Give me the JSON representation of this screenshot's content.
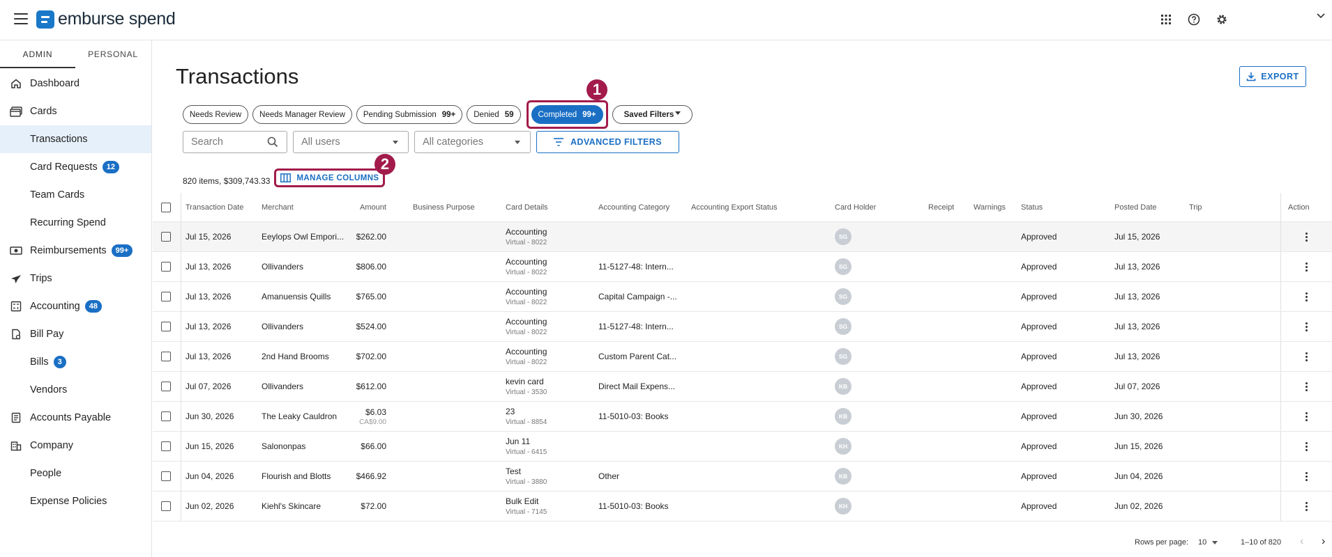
{
  "app": {
    "brand": "emburse spend"
  },
  "sidebar": {
    "tabs": [
      {
        "label": "ADMIN"
      },
      {
        "label": "PERSONAL"
      }
    ],
    "items": [
      {
        "label": "Dashboard",
        "icon": "home-icon"
      },
      {
        "label": "Cards",
        "icon": "cards-icon"
      },
      {
        "label": "Transactions"
      },
      {
        "label": "Card Requests",
        "badge": "12"
      },
      {
        "label": "Team Cards"
      },
      {
        "label": "Recurring Spend"
      },
      {
        "label": "Reimbursements",
        "badge": "99+",
        "icon": "reimbursement-icon"
      },
      {
        "label": "Trips",
        "icon": "airplane-icon"
      },
      {
        "label": "Accounting",
        "badge": "48",
        "icon": "accounting-icon"
      },
      {
        "label": "Bill Pay",
        "icon": "bill-icon"
      },
      {
        "label": "Bills",
        "badge": "3"
      },
      {
        "label": "Vendors"
      },
      {
        "label": "Accounts Payable",
        "icon": "accounts-payable-icon"
      },
      {
        "label": "Company",
        "icon": "company-icon"
      },
      {
        "label": "People"
      },
      {
        "label": "Expense Policies"
      }
    ]
  },
  "main": {
    "title": "Transactions",
    "export_label": "EXPORT",
    "chips": [
      {
        "label": "Needs Review",
        "count": ""
      },
      {
        "label": "Needs Manager Review",
        "count": ""
      },
      {
        "label": "Pending Submission",
        "count": "99+"
      },
      {
        "label": "Denied",
        "count": "59"
      },
      {
        "label": "Completed",
        "count": "99+"
      }
    ],
    "saved_filters_label": "Saved Filters",
    "markers": [
      "1",
      "2"
    ],
    "search_placeholder": "Search",
    "users_select": "All users",
    "categories_select": "All categories",
    "advanced_filters_label": "ADVANCED FILTERS",
    "summary": "820 items, $309,743.33",
    "manage_columns_label": "MANAGE COLUMNS",
    "columns": [
      "Transaction Date",
      "Merchant",
      "Amount",
      "Business Purpose",
      "Card Details",
      "Accounting Category",
      "Accounting Export Status",
      "Card Holder",
      "Receipt",
      "Warnings",
      "Status",
      "Posted Date",
      "Trip",
      "Action"
    ],
    "rows": [
      {
        "date": "Jul 15, 2026",
        "merchant": "Eeylops Owl Empori...",
        "amount": "$262.00",
        "amount_sub": "",
        "card": "Accounting",
        "card_sub": "Virtual - 8022",
        "category": "",
        "holder": "SG",
        "status": "Approved",
        "posted": "Jul 15, 2026"
      },
      {
        "date": "Jul 13, 2026",
        "merchant": "Ollivanders",
        "amount": "$806.00",
        "amount_sub": "",
        "card": "Accounting",
        "card_sub": "Virtual - 8022",
        "category": "11-5127-48: Intern...",
        "holder": "SG",
        "status": "Approved",
        "posted": "Jul 13, 2026"
      },
      {
        "date": "Jul 13, 2026",
        "merchant": "Amanuensis Quills",
        "amount": "$765.00",
        "amount_sub": "",
        "card": "Accounting",
        "card_sub": "Virtual - 8022",
        "category": "Capital Campaign -...",
        "holder": "SG",
        "status": "Approved",
        "posted": "Jul 13, 2026"
      },
      {
        "date": "Jul 13, 2026",
        "merchant": "Ollivanders",
        "amount": "$524.00",
        "amount_sub": "",
        "card": "Accounting",
        "card_sub": "Virtual - 8022",
        "category": "11-5127-48: Intern...",
        "holder": "SG",
        "status": "Approved",
        "posted": "Jul 13, 2026"
      },
      {
        "date": "Jul 13, 2026",
        "merchant": "2nd Hand Brooms",
        "amount": "$702.00",
        "amount_sub": "",
        "card": "Accounting",
        "card_sub": "Virtual - 8022",
        "category": "Custom Parent Cat...",
        "holder": "SG",
        "status": "Approved",
        "posted": "Jul 13, 2026"
      },
      {
        "date": "Jul 07, 2026",
        "merchant": "Ollivanders",
        "amount": "$612.00",
        "amount_sub": "",
        "card": "kevin card",
        "card_sub": "Virtual - 3530",
        "category": "Direct Mail Expens...",
        "holder": "KB",
        "status": "Approved",
        "posted": "Jul 07, 2026"
      },
      {
        "date": "Jun 30, 2026",
        "merchant": "The Leaky Cauldron",
        "amount": "$6.03",
        "amount_sub": "CA$9.00",
        "card": "23",
        "card_sub": "Virtual - 8854",
        "category": "11-5010-03: Books",
        "holder": "KB",
        "status": "Approved",
        "posted": "Jun 30, 2026"
      },
      {
        "date": "Jun 15, 2026",
        "merchant": "Salononpas",
        "amount": "$66.00",
        "amount_sub": "",
        "card": "Jun 11",
        "card_sub": "Virtual - 6415",
        "category": "",
        "holder": "KH",
        "status": "Approved",
        "posted": "Jun 15, 2026"
      },
      {
        "date": "Jun 04, 2026",
        "merchant": "Flourish and Blotts",
        "amount": "$466.92",
        "amount_sub": "",
        "card": "Test",
        "card_sub": "Virtual - 3880",
        "category": "Other",
        "holder": "KB",
        "status": "Approved",
        "posted": "Jun 04, 2026"
      },
      {
        "date": "Jun 02, 2026",
        "merchant": "Kiehl's Skincare",
        "amount": "$72.00",
        "amount_sub": "",
        "card": "Bulk Edit",
        "card_sub": "Virtual - 7145",
        "category": "11-5010-03: Books",
        "holder": "KH",
        "status": "Approved",
        "posted": "Jun 02, 2026"
      }
    ],
    "pager": {
      "rows_per_page_label": "Rows per page:",
      "rows_per_page": "10",
      "range": "1–10 of 820"
    }
  },
  "colors": {
    "accent": "#1a6fc4",
    "highlight": "#a21b4b",
    "active_nav": "#e6f0fa"
  }
}
